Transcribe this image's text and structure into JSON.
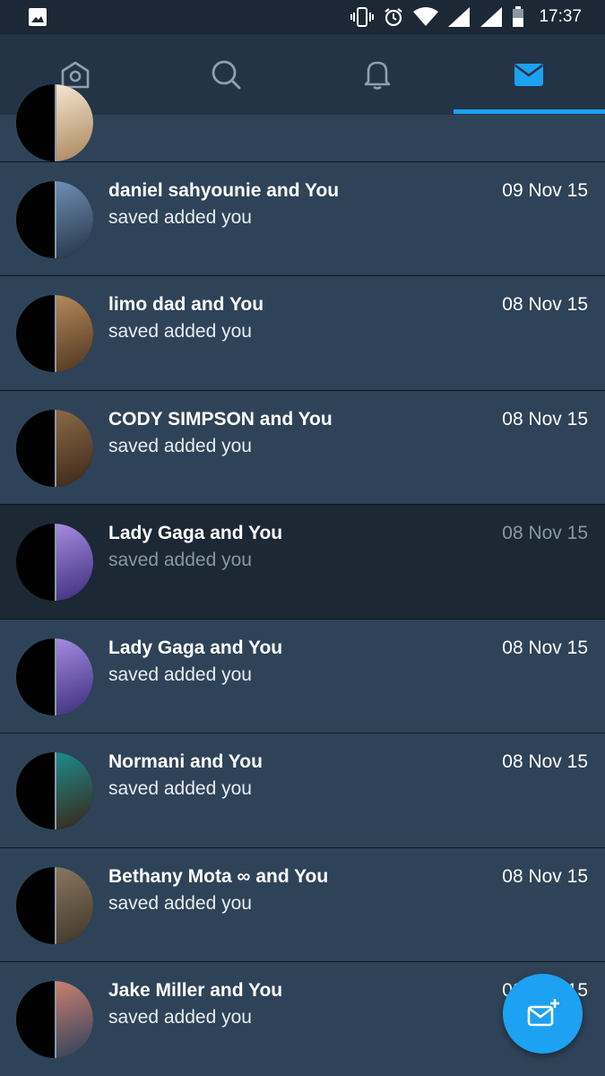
{
  "status_bar": {
    "time": "17:37"
  },
  "nav": {
    "tabs": [
      {
        "icon": "home-icon"
      },
      {
        "icon": "search-icon"
      },
      {
        "icon": "bell-icon"
      },
      {
        "icon": "mail-icon",
        "active": true
      }
    ],
    "accent": "#1da1f2"
  },
  "messages": [
    {
      "name": "daniel sahyounie and You",
      "preview": "saved added you",
      "date": "09 Nov 15",
      "avatar_colors": [
        "#6f8fb3",
        "#243246"
      ]
    },
    {
      "name": "limo dad and You",
      "preview": "saved added you",
      "date": "08 Nov 15",
      "avatar_colors": [
        "#b38a5a",
        "#4e3320"
      ]
    },
    {
      "name": "CODY SIMPSON and You",
      "preview": "saved added you",
      "date": "08 Nov 15",
      "avatar_colors": [
        "#8a6a48",
        "#3a2618"
      ]
    },
    {
      "name": "Lady Gaga and You",
      "preview": "saved added you",
      "date": "08 Nov 15",
      "selected": true,
      "avatar_colors": [
        "#a58be0",
        "#3b2b7a"
      ]
    },
    {
      "name": "Lady Gaga and You",
      "preview": "saved added you",
      "date": "08 Nov 15",
      "avatar_colors": [
        "#a58be0",
        "#3b2b7a"
      ]
    },
    {
      "name": "Normani and You",
      "preview": "saved added you",
      "date": "08 Nov 15",
      "avatar_colors": [
        "#1f8a8c",
        "#3a2416"
      ]
    },
    {
      "name": "Bethany Mota ∞ and You",
      "preview": "saved added you",
      "date": "08 Nov 15",
      "avatar_colors": [
        "#8a7660",
        "#3e3528"
      ]
    },
    {
      "name": "Jake Miller and You",
      "preview": "saved added you",
      "date": "08 Nov 15",
      "avatar_colors": [
        "#c9806e",
        "#2c3f5c"
      ]
    }
  ],
  "fab": {
    "icon": "compose-message-icon"
  }
}
